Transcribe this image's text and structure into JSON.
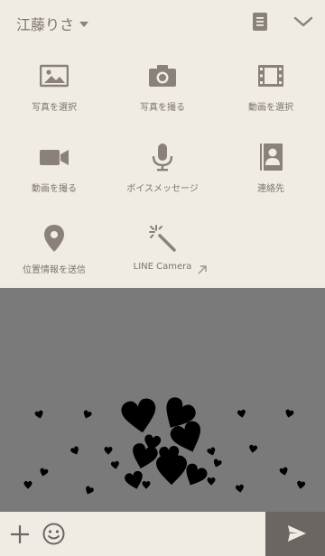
{
  "header": {
    "chat_name": "江藤りさ"
  },
  "menu": {
    "items": [
      {
        "label": "写真を選択",
        "icon": "image-icon"
      },
      {
        "label": "写真を撮る",
        "icon": "camera-icon"
      },
      {
        "label": "動画を選択",
        "icon": "film-icon"
      },
      {
        "label": "動画を撮る",
        "icon": "video-camera-icon"
      },
      {
        "label": "ボイスメッセージ",
        "icon": "microphone-icon"
      },
      {
        "label": "連絡先",
        "icon": "contact-book-icon"
      },
      {
        "label": "位置情報を送信",
        "icon": "location-pin-icon"
      },
      {
        "label": "LINE Camera",
        "icon": "magic-wand-icon"
      }
    ]
  },
  "colors": {
    "background": "#f0ebe3",
    "icon": "#8a8279",
    "text": "#7d756c",
    "chat_bg": "#7a7a7a",
    "send_bg": "#6b6661"
  }
}
